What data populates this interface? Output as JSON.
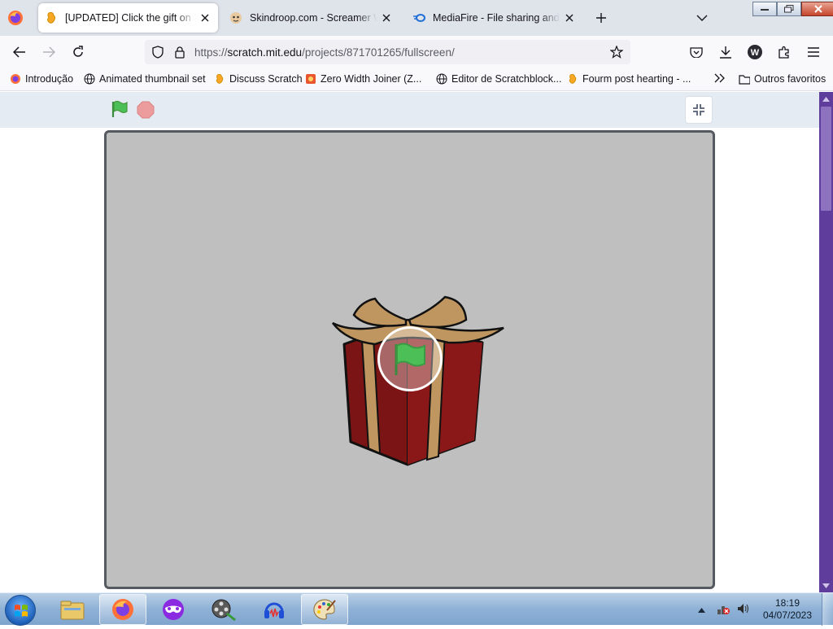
{
  "browser": {
    "tabs": [
      {
        "title": "[UPDATED] Click the gift on Scratch",
        "active": true
      },
      {
        "title": "Skindroop.com - Screamer Wiki",
        "active": false
      },
      {
        "title": "MediaFire - File sharing and storage",
        "active": false
      }
    ],
    "url": {
      "scheme": "https://",
      "host": "scratch.mit.edu",
      "path": "/projects/871701265/fullscreen/"
    },
    "bookmarks": [
      {
        "label": "Introdução",
        "icon": "firefox-icon"
      },
      {
        "label": "Animated thumbnail set",
        "icon": "globe-icon"
      },
      {
        "label": "Discuss Scratch",
        "icon": "scratch-icon"
      },
      {
        "label": "Zero Width Joiner (Z...",
        "icon": "pdf-icon"
      },
      {
        "label": "Editor de Scratchblock...",
        "icon": "globe-icon"
      },
      {
        "label": "Fourm post hearting - ...",
        "icon": "scratch-icon"
      }
    ],
    "bookmarks_folder": "Outros favoritos",
    "profile_initial": "W"
  },
  "taskbar": {
    "time": "18:19",
    "date": "04/07/2023"
  },
  "colors": {
    "stage_bg": "#bfbfbf",
    "scroll_accent": "#5e3d9c",
    "flag_green": "#4cbf56"
  }
}
